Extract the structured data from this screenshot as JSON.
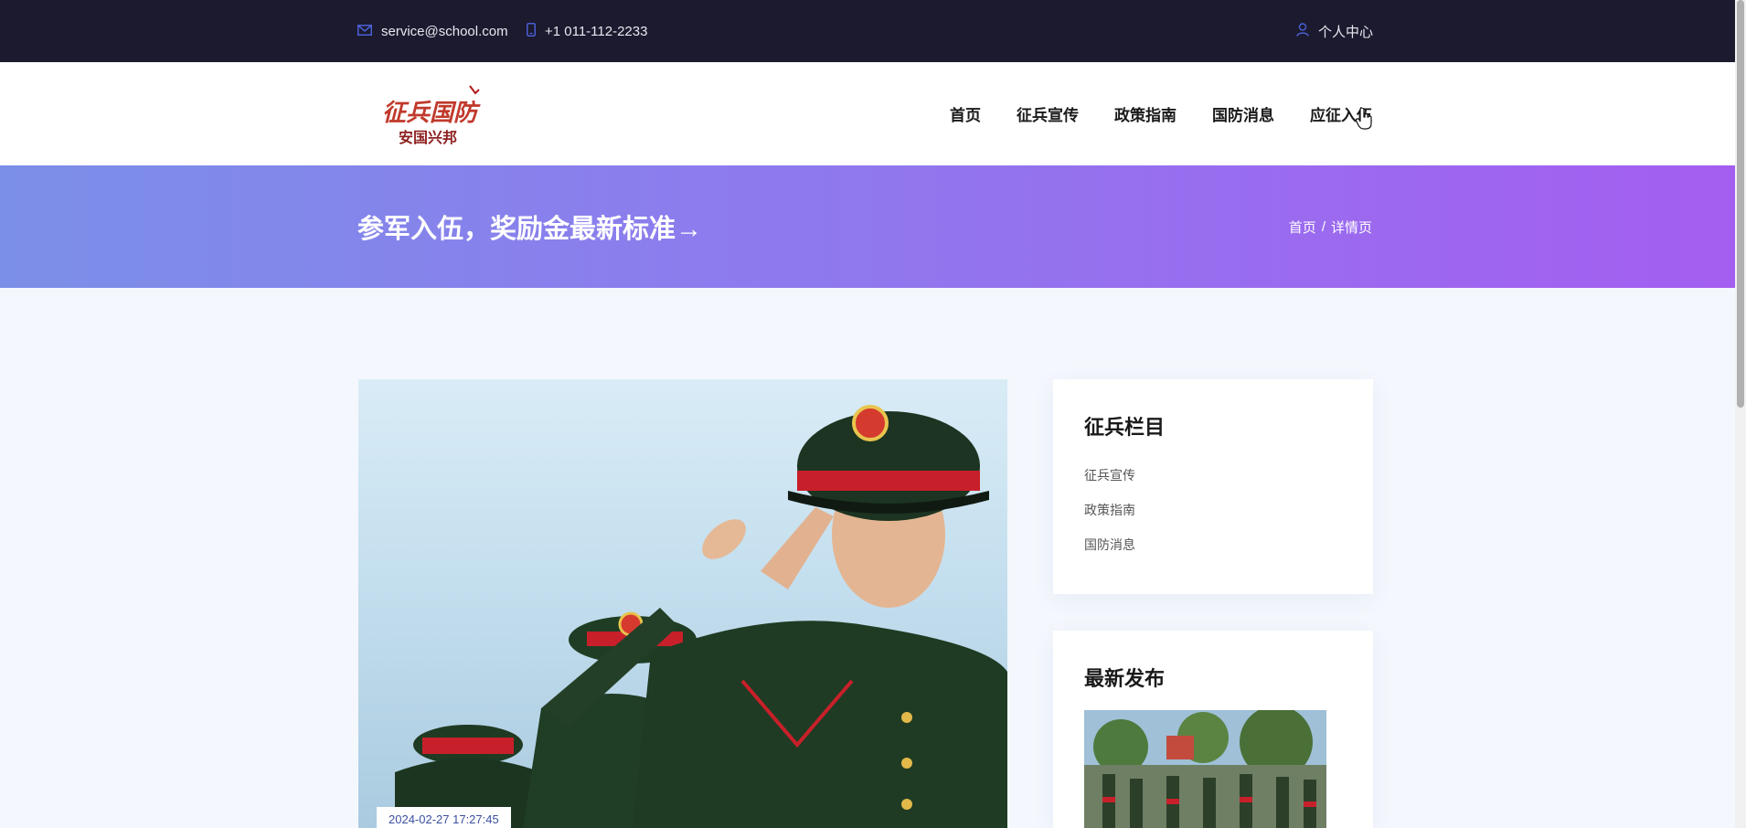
{
  "topbar": {
    "email": "service@school.com",
    "phone": "+1 011-112-2233",
    "user_center": "个人中心"
  },
  "logo": {
    "line1": "征兵国防",
    "line2": "安国兴邦"
  },
  "nav": {
    "items": [
      "首页",
      "征兵宣传",
      "政策指南",
      "国防消息",
      "应征入伍"
    ]
  },
  "banner": {
    "title": "参军入伍，奖励金最新标准→",
    "crumb_home": "首页",
    "crumb_sep": "/",
    "crumb_current": "详情页"
  },
  "article": {
    "date": "2024-02-27 17:27:45"
  },
  "sidebar": {
    "categories_title": "征兵栏目",
    "categories": [
      "征兵宣传",
      "政策指南",
      "国防消息"
    ],
    "latest_title": "最新发布"
  },
  "colors": {
    "topbar_bg": "#1c1a2e",
    "banner_start": "#7b8fe8",
    "banner_end": "#a45ef0",
    "accent_icon": "#4a5fd8"
  }
}
